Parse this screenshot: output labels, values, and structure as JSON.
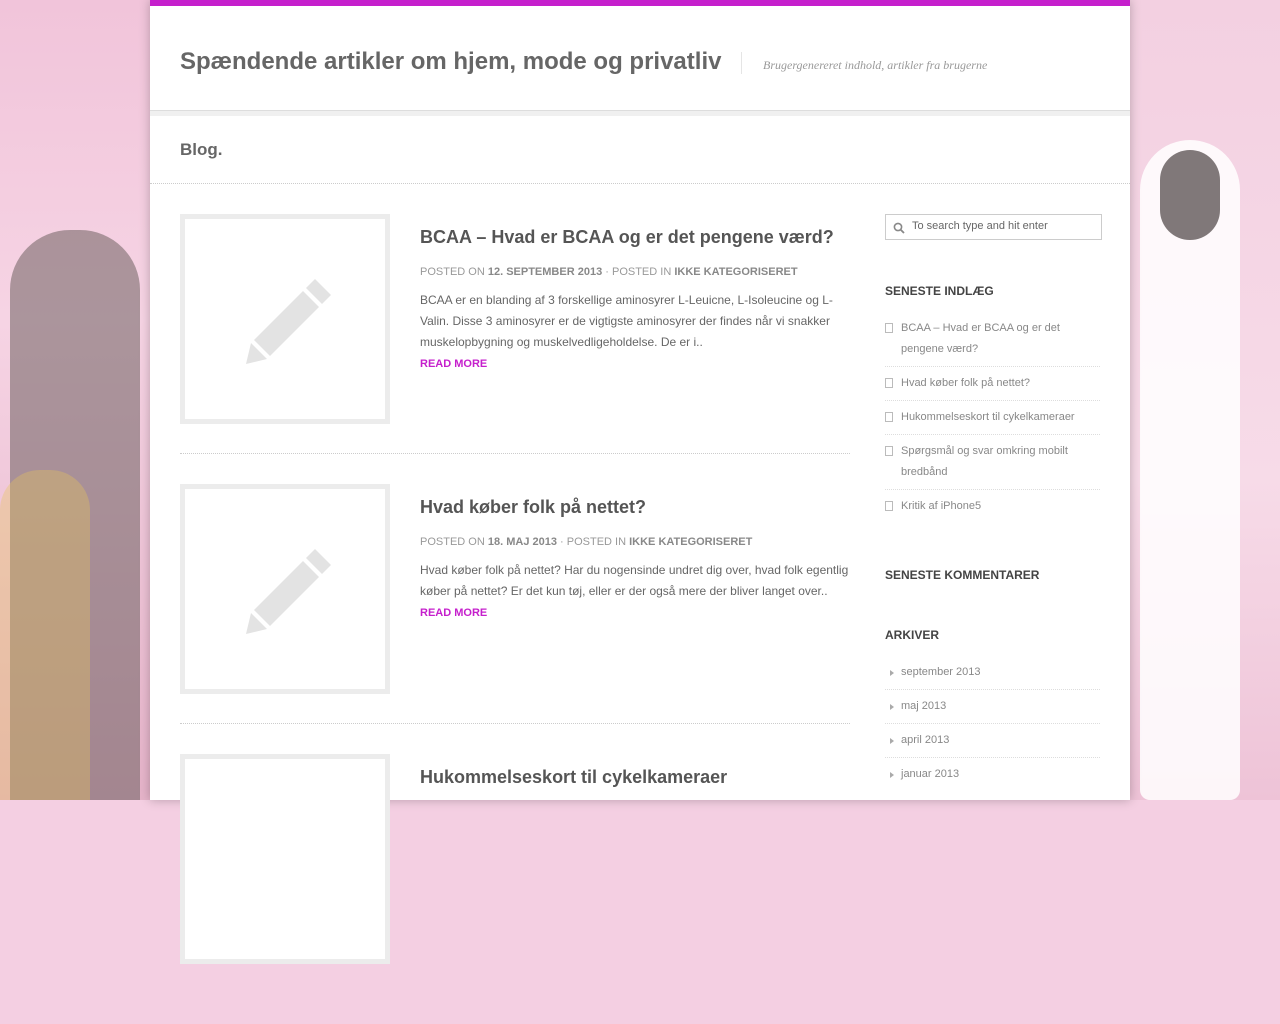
{
  "site": {
    "title": "Spændende artikler om hjem, mode og privatliv",
    "description": "Brugergenereret indhold, artikler fra brugerne",
    "accent_color": "#c51fcc"
  },
  "page": {
    "title": "Blog."
  },
  "posts": [
    {
      "title": "BCAA – Hvad er BCAA og er det pengene værd?",
      "posted_on_label": "POSTED ON",
      "date": "12. SEPTEMBER 2013",
      "posted_in_label": "· POSTED IN",
      "category": "IKKE KATEGORISERET",
      "excerpt": "BCAA  er en blanding af 3 forskellige aminosyrer L-Leuicne, L-Isoleucine og L-Valin.  Disse 3 aminosyrer er de vigtigste aminosyrer der findes når vi snakker muskelopbygning og muskelvedligeholdelse. De er i..",
      "read_more": "READ MORE",
      "thumbnail_icon": "pencil-icon"
    },
    {
      "title": "Hvad køber folk på nettet?",
      "posted_on_label": "POSTED ON",
      "date": "18. MAJ 2013",
      "posted_in_label": "· POSTED IN",
      "category": "IKKE KATEGORISERET",
      "excerpt": "Hvad køber folk på nettet? Har du nogensinde undret dig over, hvad folk egentlig køber på nettet? Er det kun tøj, eller er der også mere der bliver langet over..",
      "read_more": "READ MORE",
      "thumbnail_icon": "pencil-icon"
    },
    {
      "title": "Hukommelseskort til cykelkameraer",
      "thumbnail_icon": "pencil-icon"
    }
  ],
  "sidebar": {
    "search": {
      "placeholder": "To search type and hit enter",
      "icon": "search-icon"
    },
    "recent_posts": {
      "title": "SENESTE INDLÆG",
      "items": [
        "BCAA – Hvad er BCAA og er det pengene værd?",
        "Hvad køber folk på nettet?",
        "Hukommelseskort til cykelkameraer",
        "Spørgsmål og svar omkring mobilt bredbånd",
        "Kritik af iPhone5"
      ]
    },
    "recent_comments": {
      "title": "SENESTE KOMMENTARER"
    },
    "archives": {
      "title": "ARKIVER",
      "items": [
        "september 2013",
        "maj 2013",
        "april 2013",
        "januar 2013"
      ]
    }
  }
}
